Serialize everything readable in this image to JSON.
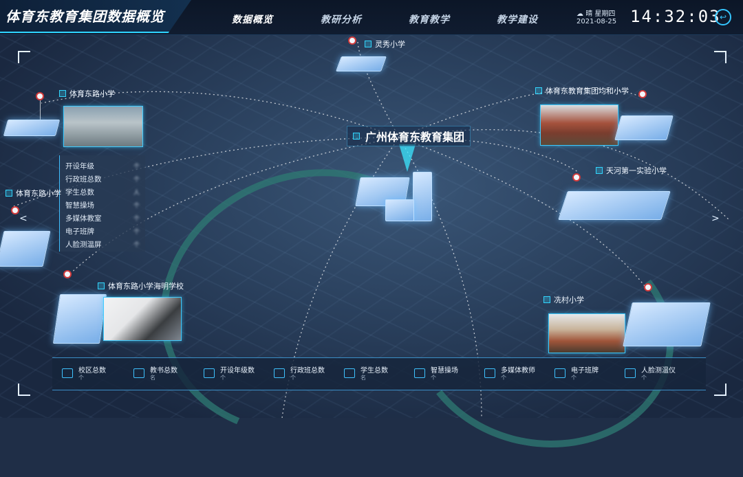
{
  "header": {
    "title": "体育东教育集团数据概览",
    "tabs": [
      {
        "label": "数据概览",
        "active": true
      },
      {
        "label": "教研分析",
        "active": false
      },
      {
        "label": "教育教学",
        "active": false
      },
      {
        "label": "教学建设",
        "active": false
      }
    ],
    "weather": "晴 星期四",
    "date": "2021-08-25",
    "time": "14:32:03",
    "back_icon": "back-arrow-icon"
  },
  "map": {
    "center_label": "广州体育东教育集团",
    "schools": [
      {
        "name": "灵秀小学"
      },
      {
        "name": "体育东路小学"
      },
      {
        "name": "体育东路小学"
      },
      {
        "name": "体育东教育集团均和小学"
      },
      {
        "name": "天河第一实验小学"
      },
      {
        "name": "体育东路小学海明学校"
      },
      {
        "name": "冼村小学"
      }
    ]
  },
  "school_stats": {
    "rows": [
      {
        "label": "开设年级",
        "value": "个"
      },
      {
        "label": "行政班总数",
        "value": "个"
      },
      {
        "label": "学生总数",
        "value": "人"
      },
      {
        "label": "智慧操场",
        "value": "个"
      },
      {
        "label": "多媒体教室",
        "value": "个"
      },
      {
        "label": "电子班牌",
        "value": "个"
      },
      {
        "label": "人脸测温屏",
        "value": "个"
      }
    ]
  },
  "bottom_metrics": [
    {
      "label": "校区总数",
      "unit": "个",
      "icon": "school-icon"
    },
    {
      "label": "教书总数",
      "unit": "名",
      "icon": "teacher-icon"
    },
    {
      "label": "开设年级数",
      "unit": "个",
      "icon": "grade-icon"
    },
    {
      "label": "行政班总数",
      "unit": "个",
      "icon": "class-icon"
    },
    {
      "label": "学生总数",
      "unit": "名",
      "icon": "student-icon"
    },
    {
      "label": "智慧操场",
      "unit": "个",
      "icon": "playground-icon"
    },
    {
      "label": "多媒体教师",
      "unit": "个",
      "icon": "multimedia-icon"
    },
    {
      "label": "电子班牌",
      "unit": "个",
      "icon": "board-icon"
    },
    {
      "label": "人脸测温仪",
      "unit": "个",
      "icon": "face-scan-icon"
    }
  ],
  "colors": {
    "accent": "#32d6ff",
    "pin": "#d33b3b",
    "background": "#1f2e47"
  }
}
